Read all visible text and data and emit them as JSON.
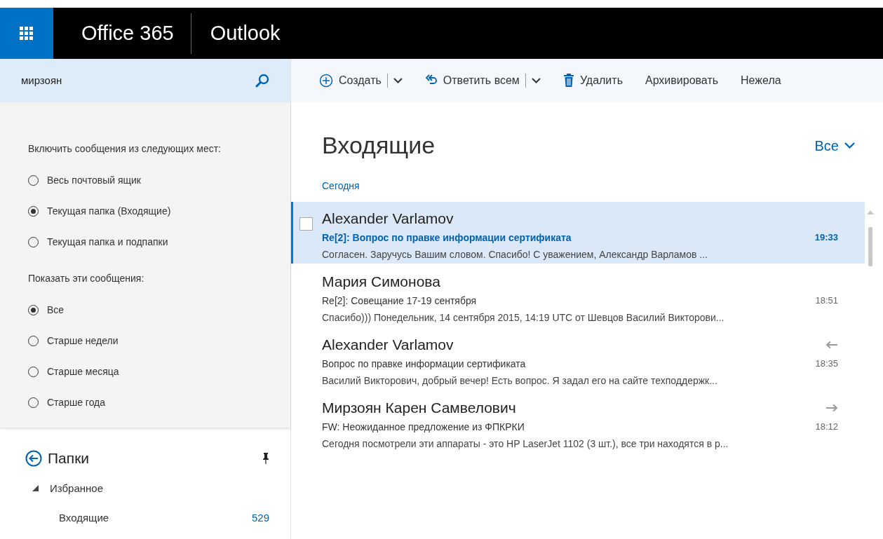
{
  "header": {
    "suite": "Office 365",
    "app": "Outlook"
  },
  "search": {
    "value": "мирзоян"
  },
  "toolbar": [
    {
      "label": "Создать",
      "kind": "new"
    },
    {
      "kind": "dropdown"
    },
    {
      "label": "Ответить всем",
      "kind": "reply-all"
    },
    {
      "kind": "dropdown"
    },
    {
      "label": "Удалить",
      "kind": "delete"
    },
    {
      "label": "Архивировать",
      "kind": "plain"
    },
    {
      "label": "Нежела",
      "kind": "plain"
    }
  ],
  "filters": [
    {
      "title": "Включить сообщения из следующих мест:",
      "options": [
        {
          "label": "Весь почтовый ящик",
          "selected": false
        },
        {
          "label": "Текущая папка (Входящие)",
          "selected": true
        },
        {
          "label": "Текущая папка и подпапки",
          "selected": false
        }
      ]
    },
    {
      "title": "Показать эти сообщения:",
      "options": [
        {
          "label": "Все",
          "selected": true
        },
        {
          "label": "Старше недели",
          "selected": false
        },
        {
          "label": "Старше месяца",
          "selected": false
        },
        {
          "label": "Старше года",
          "selected": false
        }
      ]
    }
  ],
  "folders": {
    "title": "Папки",
    "items": [
      {
        "label": "Избранное",
        "expanded": true,
        "children": [
          {
            "label": "Входящие",
            "count": "529"
          }
        ]
      }
    ]
  },
  "mail_list": {
    "title": "Входящие",
    "filter": "Все",
    "group": "Сегодня",
    "messages": [
      {
        "sender": "Alexander Varlamov",
        "subject": "Re[2]: Вопрос по правке информации сертификата",
        "time": "19:33",
        "preview": "Согласен. Заручусь Вашим словом.  Спасибо!  С уважением, Александр Варламов   ...",
        "selected": true,
        "kind": "none"
      },
      {
        "sender": "Мария Симонова",
        "subject": "Re[2]: Совещание 17-19 сентября",
        "time": "18:51",
        "preview": "Спасибо)))   Понедельник, 14 сентября 2015, 14:19 UTC от Шевцов Василий Викторови...",
        "selected": false,
        "kind": "none"
      },
      {
        "sender": "Alexander Varlamov",
        "subject": "Вопрос по правке информации сертификата",
        "time": "18:35",
        "preview": "Василий Викторович, добрый вечер!  Есть вопрос. Я задал его на сайте техподдержк...",
        "selected": false,
        "kind": "replied"
      },
      {
        "sender": "Мирзоян Карен Самвелович",
        "subject": "FW: Неожиданное предложение из ФПКРКИ",
        "time": "18:12",
        "preview": "Сегодня посмотрели эти аппараты - это HP LaserJet 1102 (3 шт.), все три находятся в р...",
        "selected": false,
        "kind": "forwarded"
      }
    ]
  }
}
